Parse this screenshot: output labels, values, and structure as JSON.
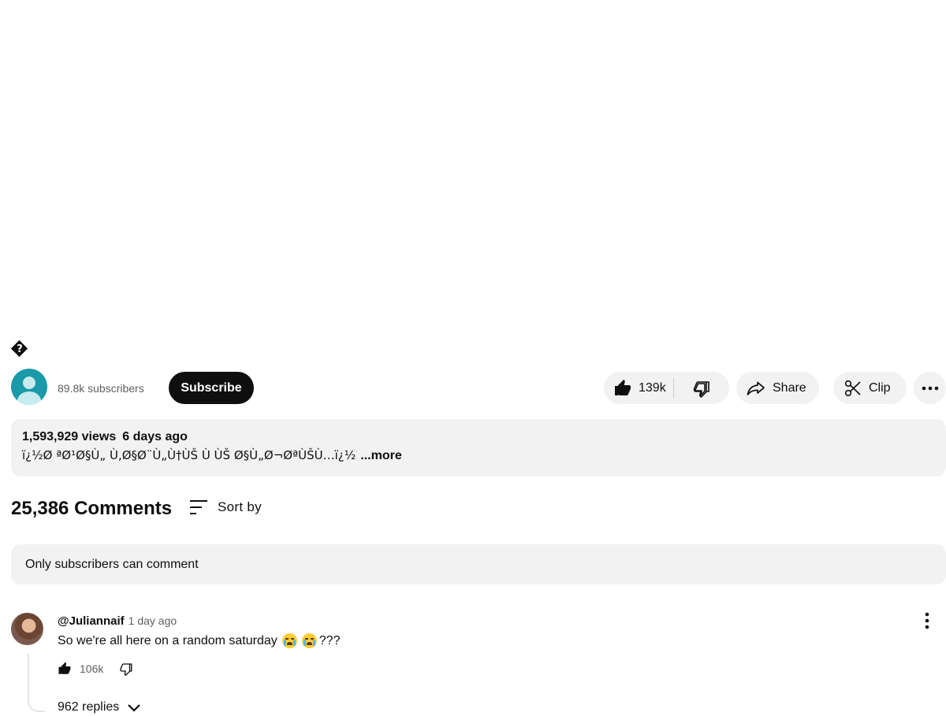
{
  "video": {
    "title": "�"
  },
  "owner": {
    "avatar": "default-avatar-icon",
    "subscribers": "89.8k subscribers",
    "subscribe_label": "Subscribe"
  },
  "actions": {
    "like_count": "139k",
    "share_label": "Share",
    "clip_label": "Clip"
  },
  "description": {
    "views": "1,593,929 views",
    "date": "6 days ago",
    "text": "ï¿½Ø ªØ¹Ø§Ù„ Ù‚Ø§Ø¨Ù„Ù†ÙŠ Ù  ÙŠ Ø§Ù„Ø¬ØªÙŠÙ…ï¿½",
    "more_label": "...more"
  },
  "comments": {
    "count_label": "25,386 Comments",
    "sort_label": "Sort by",
    "restriction_notice": "Only subscribers can comment",
    "items": [
      {
        "author": "@Juliannaif",
        "time": "1 day ago",
        "text": "So we're all here on a random saturday",
        "emojis": [
          "loudly-crying-face-icon",
          "loudly-crying-face-icon"
        ],
        "suffix": "???",
        "likes": "106k",
        "replies_label": "962 replies"
      }
    ]
  },
  "colors": {
    "subscribe_bg": "#0f0f0f",
    "pill_bg": "#f2f2f2",
    "avatar_bg": "#1a99a8",
    "secondary_text": "#606060"
  }
}
